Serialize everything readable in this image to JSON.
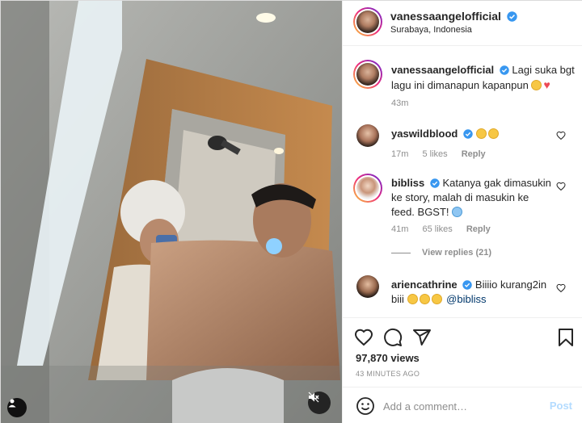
{
  "post": {
    "username": "vanessaangelofficial",
    "location": "Surabaya, Indonesia",
    "verified": true
  },
  "caption": {
    "username": "vanessaangelofficial",
    "text": "Lagi suka bgt lagu ini dimanapun kapanpun",
    "time": "43m"
  },
  "comments": [
    {
      "username": "yaswildblood",
      "text": "",
      "time": "17m",
      "likes": "5 likes",
      "reply": "Reply"
    },
    {
      "username": "bibliss",
      "text": "Katanya gak dimasukin ke story, malah di masukin ke feed. BGST!",
      "time": "41m",
      "likes": "65 likes",
      "reply": "Reply",
      "view_replies": "View replies (21)"
    },
    {
      "username": "ariencathrine",
      "text": "Biiiio kurang2in biii",
      "mention": "@bibliss"
    }
  ],
  "stats": {
    "views": "97,870 views",
    "posted": "43 MINUTES AGO"
  },
  "composer": {
    "placeholder": "Add a comment…",
    "post_label": "Post"
  },
  "icons": {
    "like": "heart-icon",
    "comment": "comment-icon",
    "share": "paper-plane-icon",
    "save": "bookmark-icon",
    "emoji": "smiley-icon",
    "mute": "speaker-muted-icon",
    "tag": "user-tag-icon"
  },
  "colors": {
    "verified": "#3897f0",
    "post_disabled": "#b3dbff",
    "muted_text": "#8e8e8e",
    "heart_red": "#ed4956"
  }
}
